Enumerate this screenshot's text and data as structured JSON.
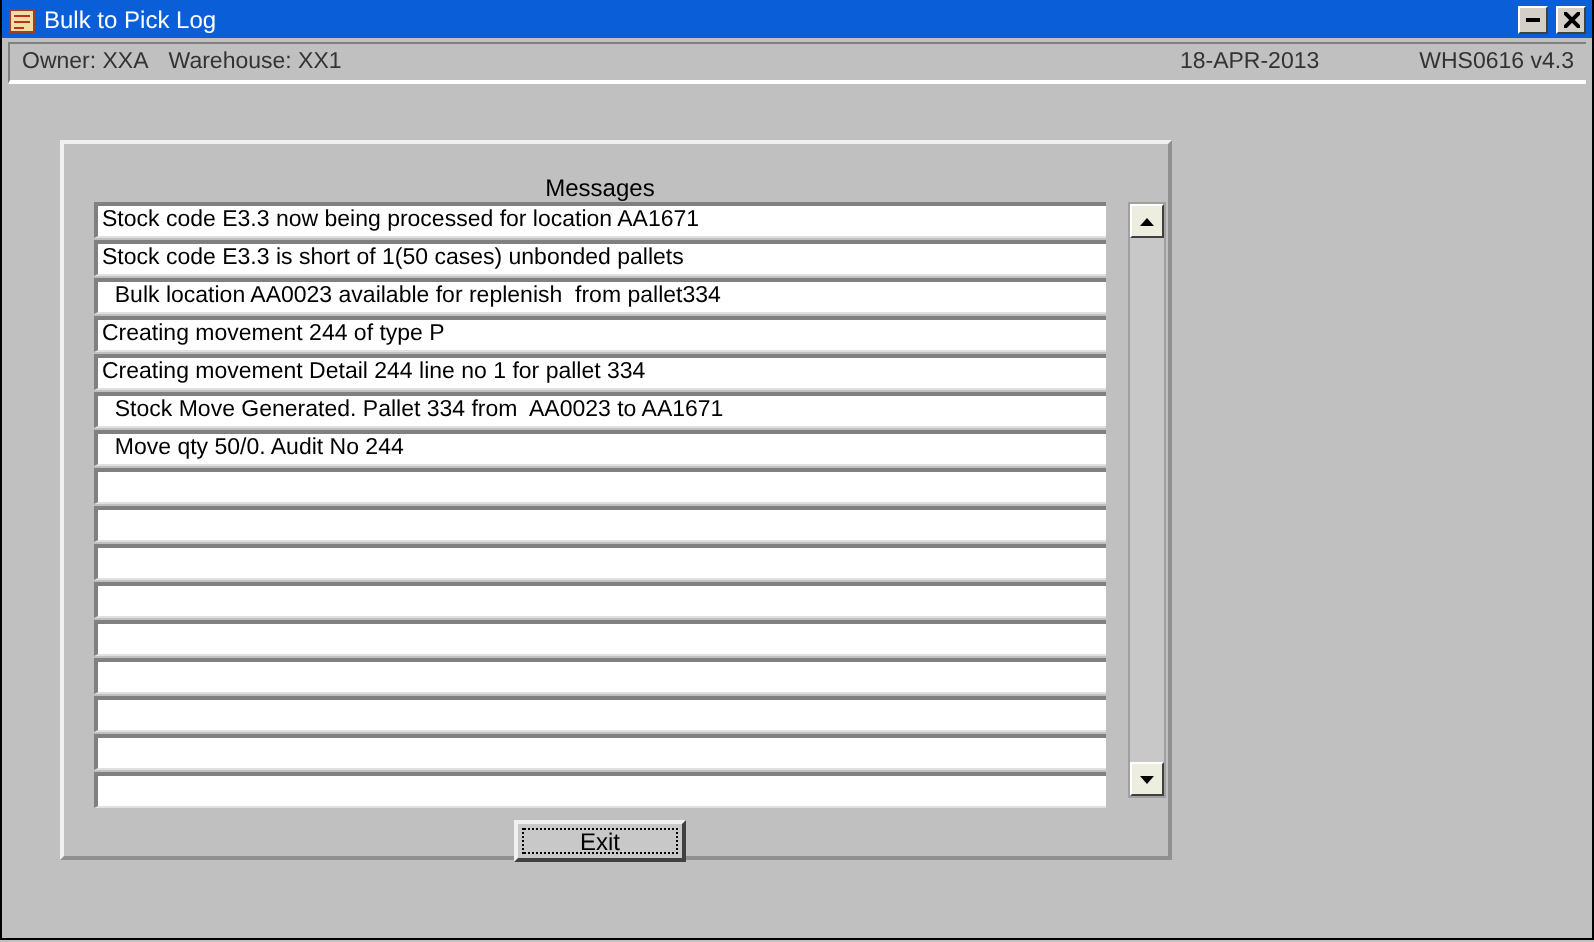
{
  "window": {
    "title": "Bulk to Pick Log"
  },
  "info_bar": {
    "owner": "Owner:  XXA",
    "warehouse": "Warehouse:  XX1",
    "date": "18-APR-2013",
    "version": "WHS0616  v4.3"
  },
  "messages": {
    "heading": "Messages",
    "rows": [
      {
        "kind": "text",
        "text": "Stock code E3.3 now being processed for location AA1671"
      },
      {
        "kind": "text",
        "text": "Stock code E3.3 is short of 1(50 cases) unbonded pallets"
      },
      {
        "kind": "text",
        "text": "  Bulk location AA0023 available for replenish  from pallet334"
      },
      {
        "kind": "text",
        "text": "Creating movement 244 of type P"
      },
      {
        "kind": "text",
        "text": "Creating movement Detail 244 line no 1 for pallet 334"
      },
      {
        "kind": "text",
        "text": "  Stock Move Generated. Pallet 334 from  AA0023 to AA1671"
      },
      {
        "kind": "text",
        "text": "  Move qty 50/0. Audit No 244"
      },
      {
        "kind": "empty"
      },
      {
        "kind": "empty"
      },
      {
        "kind": "empty"
      },
      {
        "kind": "empty"
      },
      {
        "kind": "empty"
      },
      {
        "kind": "empty"
      },
      {
        "kind": "empty"
      },
      {
        "kind": "empty"
      },
      {
        "kind": "empty"
      }
    ]
  },
  "buttons": [
    {
      "label": "Exit"
    }
  ]
}
